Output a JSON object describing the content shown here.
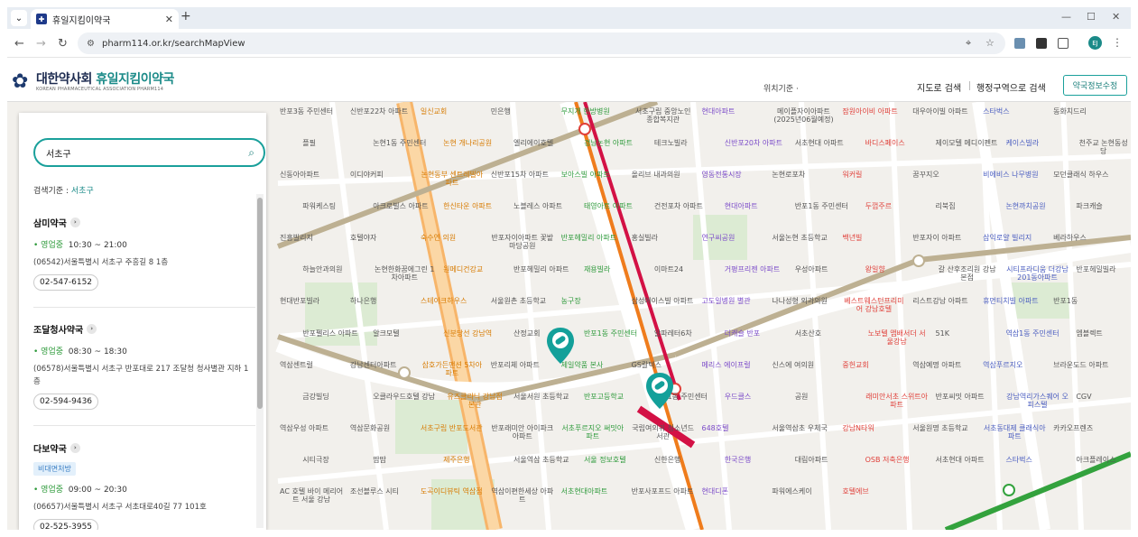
{
  "browser": {
    "tab_title": "휴일지킴이약국",
    "url": "pharm114.or.kr/searchMapView",
    "profile_initials": "EJ"
  },
  "header": {
    "logo_main": "대한약사회",
    "logo_accent": "휴일지킴이약국",
    "logo_sub": "KOREAN PHARMACEUTICAL ASSOCIATION PHARM114",
    "location_basis": "위치기준 ·",
    "nav_map_search": "지도로 검색",
    "nav_region_search": "행정구역으로 검색",
    "info_button": "약국정보수정"
  },
  "panel": {
    "search_value": "서초구",
    "basis_label": "검색기준 :",
    "basis_value": "서초구",
    "pharmacies": [
      {
        "name": "삼미약국",
        "tag": "",
        "status": "영업중",
        "hours": "10:30 ~ 21:00",
        "address": "(06542)서울특별시 서초구 주흥길 8 1층",
        "phone": "02-547-6152"
      },
      {
        "name": "조달청사약국",
        "tag": "",
        "status": "영업중",
        "hours": "08:30 ~ 18:30",
        "address": "(06578)서울특별시 서초구 반포대로 217 조달청 청사별관 지하 1층",
        "phone": "02-594-9436"
      },
      {
        "name": "다보약국",
        "tag": "비대면처방",
        "status": "영업중",
        "hours": "09:00 ~ 20:30",
        "address": "(06657)서울특별시 서초구 서초대로40길 77 101호",
        "phone": "02-525-3955"
      }
    ]
  },
  "colors": {
    "accent": "#1aa09b",
    "subway_line2": "#33a23d",
    "subway_line3": "#ef7c1c",
    "subway_line9": "#bdb092",
    "subway_sinbundang": "#d31145"
  },
  "map_labels": [
    "반포3동 주민센터",
    "신반포22차 아파트",
    "일신교회",
    "민은행",
    "무지개 한방병원",
    "서초구립 중앙노인 종합복지관",
    "현대아파트",
    "메이플자이아파트 (2025년06월예정)",
    "잠원아이비 아파트",
    "대우아이빌 아파트",
    "스타벅스",
    "동화치드리",
    "플필",
    "논현1동 주민센터",
    "논현 개나리공원",
    "엘리에이호텔",
    "경남논현 아파트",
    "테크노빌라",
    "신반포20차 아파트",
    "서초현대 아파트",
    "바디스페이스",
    "제이모텔 메디이펜트",
    "케이스빌라",
    "천주교 논현동성당",
    "신동아아파트",
    "이디야커피",
    "논현동부 센트레빌아파트",
    "신반포15차 아파트",
    "보아스빌 아파트",
    "올리브 내과의원",
    "영동전통시장",
    "논현로포차",
    "워커릴",
    "꿈꾸지오",
    "비에비스 나무병원",
    "모던클래식 하우스",
    "파워케스팅",
    "아크로빌스 아파트",
    "한신타운 아파트",
    "노블레스 아파트",
    "태영아트 아파트",
    "건전포차 아파트",
    "현대아파트",
    "반포1동 주민센터",
    "두껍주르",
    "리북집",
    "논현까치공원",
    "파크캐슬",
    "진흥빌리지",
    "호텔야자",
    "숙수연 의원",
    "반포자이아파트 꽃밭마당공원",
    "반포헤밀리 아파트",
    "홍실빌라",
    "연구씨공원",
    "서울논현 초등학교",
    "백년빌",
    "반포자이 아파트",
    "삼익로얄 빌리지",
    "베라하우스",
    "하늘안과의원",
    "논현한화꿈에그린 1차아파트",
    "원메디건강교",
    "반포헤밀리 아파트",
    "재용빌라",
    "이마트24",
    "거평프리젠 아파트",
    "우성아파트",
    "왕일향",
    "갈 산후조리원 강남본점",
    "시티프라디움 더강남201동아파트",
    "반포헤밀빌라",
    "현대반포빌라",
    "하나은행",
    "스테이크하우스",
    "서울원촌 초등학교",
    "농구장",
    "삼성에이스빌 아파트",
    "고도일병원 별관",
    "나나성형 외과의원",
    "베스트웨스턴프리미어 강남호텔",
    "리스트강남 아파트",
    "휴먼티치빌 아파트",
    "반포1동",
    "반포펠리스 아파트",
    "알크모텔",
    "신분당선 강남역",
    "산정교회",
    "반포1동 주민센터",
    "알파레터6차",
    "더캐슬 반포",
    "서초산호",
    "노보텔 앰배서더 서울강남",
    "51K",
    "역삼1동 주민센터",
    "엠블렉트",
    "역삼센트럴",
    "강남센터아파트",
    "삼호가든맨션 5차아파트",
    "반포리체 아파트",
    "제일약품 본사",
    "GS칼텍스",
    "메리스 에이프럴",
    "신스에 여의원",
    "중헌교회",
    "역삼예명 아파트",
    "역삼푸르지오",
    "브라운도드 아파트",
    "금강빌딩",
    "오클라우드호텔 강남",
    "유즈클리닉 강남점 본관",
    "서울서원 초등학교",
    "반포고등학교",
    "서초1동 주민센터",
    "우드클스",
    "공원",
    "래미안서초 스위트아파트",
    "반포씨밋 아파트",
    "강남역리가스퀘어 오피스텔",
    "CGV",
    "역삼우성 아파트",
    "역삼문화공원",
    "서초구립 반포도서관",
    "반포래미안 아이파크아파트",
    "서초푸르지오 써밋아파트",
    "국립여의귀 청소년드서관",
    "648호텔",
    "서울역삼초 우체국",
    "강남N타워",
    "서울원명 초등학교",
    "서초동대제 클래식아파트",
    "카카오프렌즈",
    "시티극장",
    "땀땀",
    "제주은행",
    "서울역삼 초등학교",
    "서울 정보호텔",
    "신한은행",
    "한국은행",
    "대림아파트",
    "OSB 저축은행",
    "서초현대 아파트",
    "스타벅스",
    "아크플레이스",
    "AC 호텔 바이 메리어트 서울 강남",
    "조선블루스 시티",
    "도곡이디뷰틱 역삼점",
    "역삼이편한세상 아파트",
    "서초현대아파트",
    "반포사포프드 아파트",
    "현대디폰",
    "파워에스케이",
    "호텔에브"
  ]
}
